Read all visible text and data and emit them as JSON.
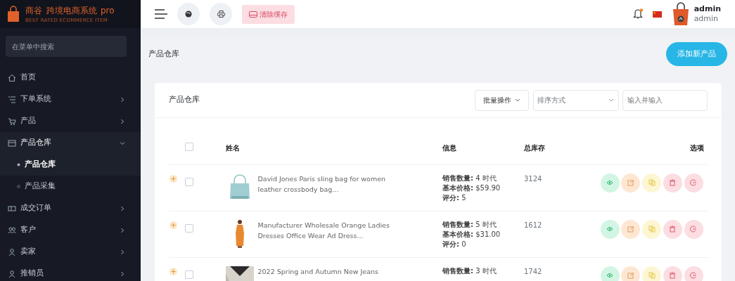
{
  "brand": {
    "name": "商谷",
    "product": "跨境电商系统",
    "edition": "pro",
    "tagline": "BEST RATED ECOMMERCE ITEM"
  },
  "sidebar": {
    "search_placeholder": "在菜单中搜索",
    "items": [
      {
        "label": "首页",
        "kind": "link"
      },
      {
        "label": "下单系统",
        "kind": "group",
        "expanded": false
      },
      {
        "label": "产品",
        "kind": "group",
        "expanded": false
      },
      {
        "label": "产品仓库",
        "kind": "group",
        "expanded": true,
        "children": [
          {
            "label": "产品仓库",
            "selected": true
          },
          {
            "label": "产品采集",
            "selected": false
          }
        ]
      },
      {
        "label": "成交订单",
        "kind": "group",
        "expanded": false
      },
      {
        "label": "客户",
        "kind": "group",
        "expanded": false
      },
      {
        "label": "卖家",
        "kind": "group",
        "expanded": false
      },
      {
        "label": "推销员",
        "kind": "group",
        "expanded": false
      }
    ]
  },
  "topbar": {
    "clear_cache": "清除缓存",
    "notification_unread": true,
    "user": {
      "name": "admin",
      "role": "admin"
    }
  },
  "page": {
    "title": "产品仓库",
    "add_button": "添加新产品"
  },
  "card": {
    "title": "产品仓库",
    "bulk_action": "批量操作",
    "sort_placeholder": "排序方式",
    "search_placeholder": "输入并输入"
  },
  "table": {
    "columns": [
      "姓名",
      "信息",
      "总库存",
      "选项"
    ],
    "all_checked": false,
    "rows": [
      {
        "checked": false,
        "name": "David Jones Paris sling bag for women leather crossbody bag...",
        "info": [
          "**销售数量:** 4 时代",
          "**基本价格:** $59.90",
          "**评分:** 5"
        ],
        "stock": "3124"
      },
      {
        "checked": false,
        "name": "Manufacturer Wholesale Orange Ladies Dresses Office Wear Ad Dress...",
        "info": [
          "**销售数量:** 5 时代",
          "**基本价格:** $31.00",
          "**评分:** 0"
        ],
        "stock": "1612"
      },
      {
        "checked": false,
        "name": "2022 Spring and Autumn New Jeans",
        "info": [
          "**销售数量:** 3 时代"
        ],
        "stock": "1742"
      }
    ],
    "actions": [
      {
        "kind": "view",
        "color": "#d3f5e3"
      },
      {
        "kind": "edit",
        "color": "#fde7d3"
      },
      {
        "kind": "copy",
        "color": "#fdf6d3"
      },
      {
        "kind": "delete",
        "color": "#fbdde2"
      },
      {
        "kind": "logout",
        "color": "#fbdde2"
      }
    ]
  }
}
